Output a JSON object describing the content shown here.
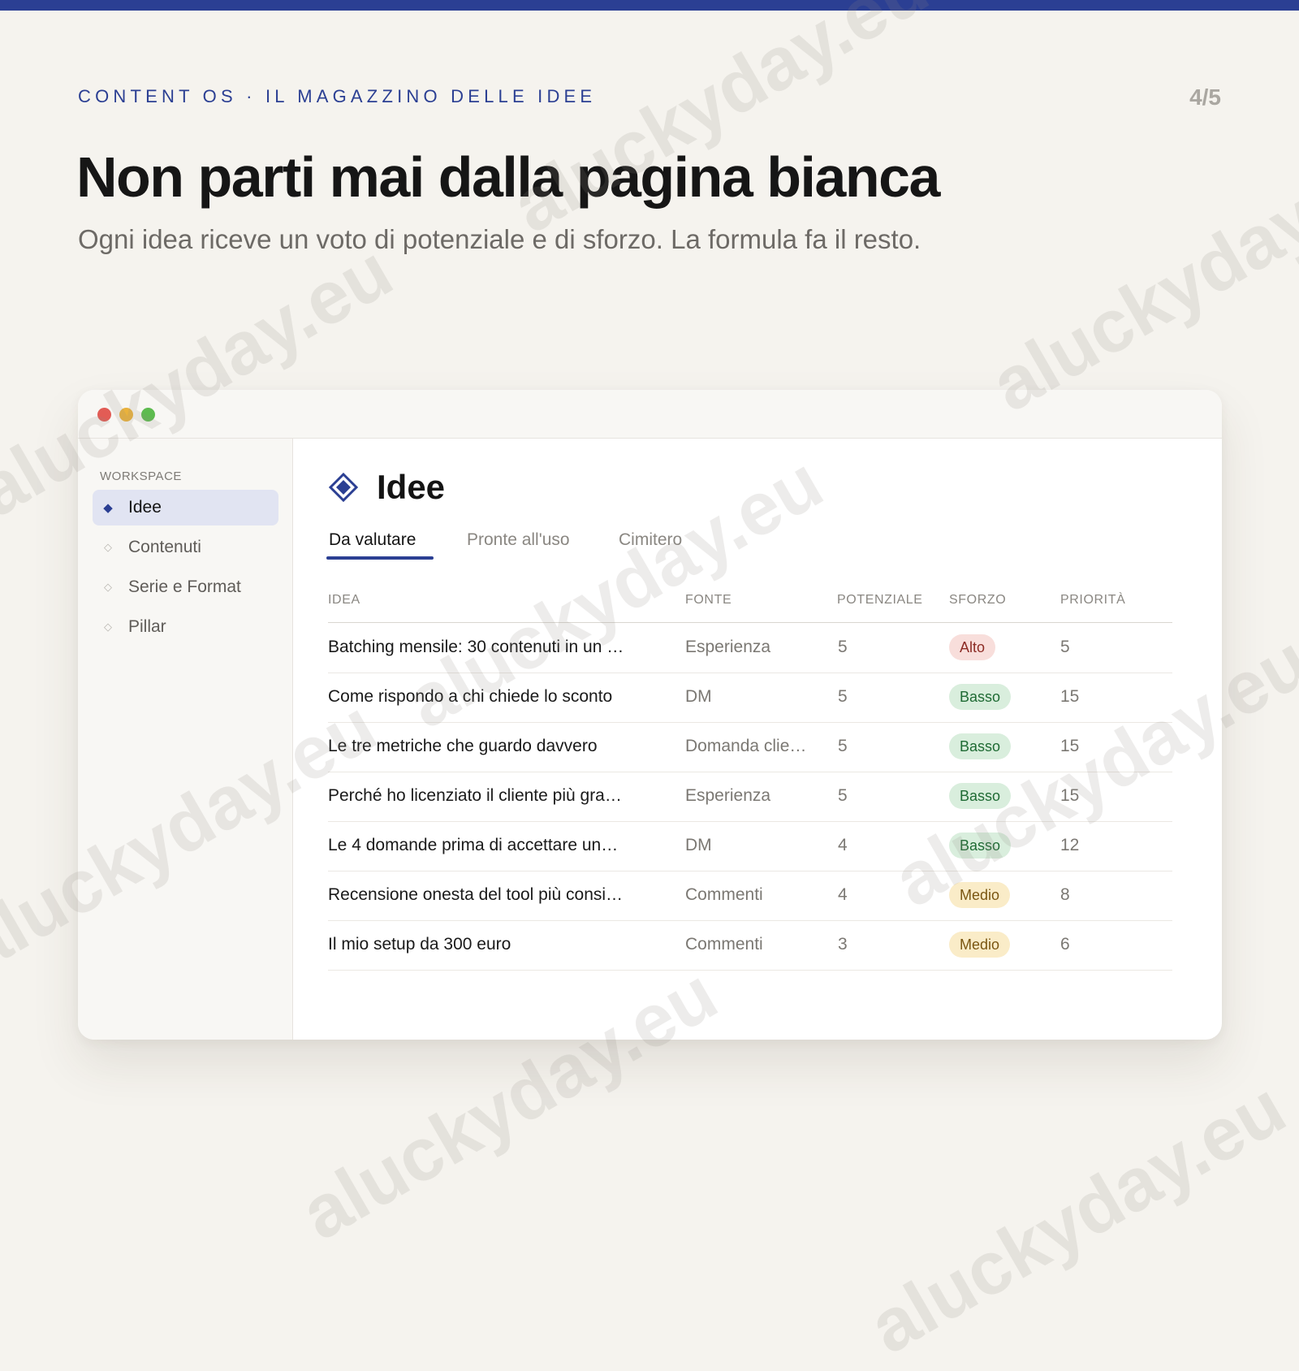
{
  "header": {
    "eyebrow": "CONTENT OS · IL MAGAZZINO DELLE IDEE",
    "page_indicator": "4/5",
    "headline": "Non parti mai dalla pagina bianca",
    "subhead": "Ogni idea riceve un voto di potenziale e di sforzo. La formula fa il resto."
  },
  "colors": {
    "accent": "#2b3f93",
    "background": "#f5f3ee",
    "badge_alto": "#f8dedb",
    "badge_basso": "#d9eedd",
    "badge_medio": "#faecc8"
  },
  "window": {
    "controls": [
      "close",
      "minimize",
      "maximize"
    ]
  },
  "sidebar": {
    "heading": "WORKSPACE",
    "items": [
      {
        "label": "Idee",
        "icon": "diamond-filled-icon",
        "active": true
      },
      {
        "label": "Contenuti",
        "icon": "diamond-outline-icon",
        "active": false
      },
      {
        "label": "Serie e Format",
        "icon": "diamond-outline-icon",
        "active": false
      },
      {
        "label": "Pillar",
        "icon": "diamond-outline-icon",
        "active": false
      }
    ]
  },
  "main": {
    "icon": "diamond-icon",
    "title": "Idee",
    "tabs": [
      {
        "label": "Da valutare",
        "active": true
      },
      {
        "label": "Pronte all'uso",
        "active": false
      },
      {
        "label": "Cimitero",
        "active": false
      }
    ],
    "table": {
      "columns": [
        "IDEA",
        "FONTE",
        "POTENZIALE",
        "SFORZO",
        "PRIORITÀ"
      ],
      "rows": [
        {
          "idea": "Batching mensile: 30 contenuti in un …",
          "fonte": "Esperienza",
          "potenziale": "5",
          "sforzo": "Alto",
          "priorita": "5"
        },
        {
          "idea": "Come rispondo a chi chiede lo sconto",
          "fonte": "DM",
          "potenziale": "5",
          "sforzo": "Basso",
          "priorita": "15"
        },
        {
          "idea": "Le tre metriche che guardo davvero",
          "fonte": "Domanda clie…",
          "potenziale": "5",
          "sforzo": "Basso",
          "priorita": "15"
        },
        {
          "idea": "Perché ho licenziato il cliente più gra…",
          "fonte": "Esperienza",
          "potenziale": "5",
          "sforzo": "Basso",
          "priorita": "15"
        },
        {
          "idea": "Le 4 domande prima di accettare un…",
          "fonte": "DM",
          "potenziale": "4",
          "sforzo": "Basso",
          "priorita": "12"
        },
        {
          "idea": "Recensione onesta del tool più consi…",
          "fonte": "Commenti",
          "potenziale": "4",
          "sforzo": "Medio",
          "priorita": "8"
        },
        {
          "idea": "Il mio setup da 300 euro",
          "fonte": "Commenti",
          "potenziale": "3",
          "sforzo": "Medio",
          "priorita": "6"
        }
      ]
    }
  },
  "watermark": "aluckyday.eu"
}
